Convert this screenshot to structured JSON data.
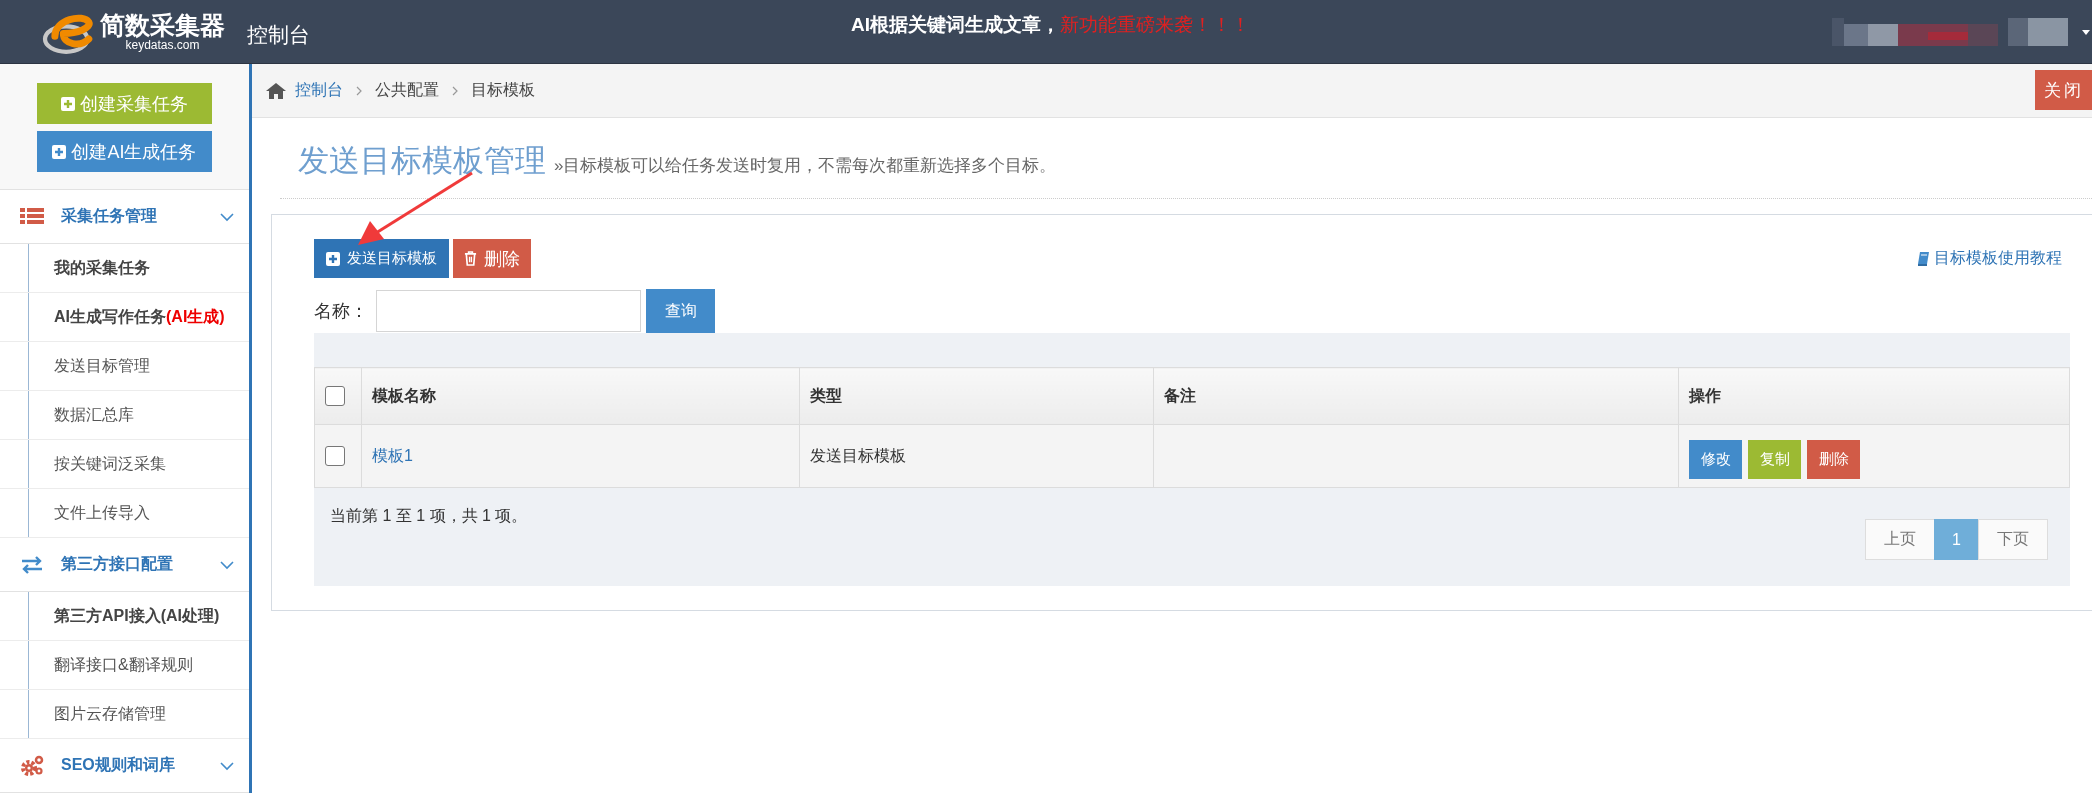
{
  "header": {
    "logo": {
      "title": "简数采集器",
      "domain": "keydatas.com"
    },
    "console_label": "控制台",
    "announcement": {
      "text": "AI根据关键词生成文章，",
      "highlight": "新功能重磅来袭！！！"
    }
  },
  "sidebar": {
    "buttons": [
      {
        "label": "创建采集任务",
        "color": "#9cba33"
      },
      {
        "label": "创建AI生成任务",
        "color": "#428bca"
      }
    ],
    "sections": [
      {
        "title": "采集任务管理",
        "expanded": true,
        "items": [
          {
            "label": "我的采集任务",
            "bold": true
          },
          {
            "label": "AI生成写作任务",
            "bold": true,
            "tag": "(AI生成)"
          },
          {
            "label": "发送目标管理",
            "bold": false
          },
          {
            "label": "数据汇总库",
            "bold": false
          },
          {
            "label": "按关键词泛采集",
            "bold": false
          },
          {
            "label": "文件上传导入",
            "bold": false
          }
        ]
      },
      {
        "title": "第三方接口配置",
        "expanded": true,
        "items": [
          {
            "label": "第三方API接入(AI处理)",
            "bold": true
          },
          {
            "label": "翻译接口&翻译规则",
            "bold": false
          },
          {
            "label": "图片云存储管理",
            "bold": false
          }
        ]
      },
      {
        "title": "SEO规则和词库",
        "expanded": true
      }
    ]
  },
  "breadcrumb": [
    {
      "label": "控制台",
      "link": true
    },
    {
      "label": "公共配置",
      "link": false
    },
    {
      "label": "目标模板",
      "link": false
    }
  ],
  "close_button": "关闭",
  "page_title": "发送目标模板管理",
  "page_subtitle": "»目标模板可以给任务发送时复用，不需每次都重新选择多个目标。",
  "toolbar": [
    {
      "label": "发送目标模板",
      "kind": "add"
    },
    {
      "label": "删除",
      "kind": "delete"
    }
  ],
  "help_link": "目标模板使用教程",
  "search": {
    "label": "名称：",
    "button": "查询"
  },
  "table": {
    "select_all_checked": false,
    "columns": [
      "模板名称",
      "类型",
      "备注",
      "操作"
    ],
    "rows": [
      {
        "checked": false,
        "name": "模板1",
        "type": "发送目标模板",
        "actions": [
          {
            "label": "修改",
            "kind": "edit"
          },
          {
            "label": "复制",
            "kind": "copy"
          },
          {
            "label": "删除",
            "kind": "delete"
          }
        ]
      }
    ],
    "info": "当前第 1 至 1 项，共 1 项。",
    "pagination": [
      {
        "label": "上页",
        "selected": false
      },
      {
        "label": "1",
        "selected": true
      },
      {
        "label": "下页",
        "selected": false
      }
    ]
  }
}
